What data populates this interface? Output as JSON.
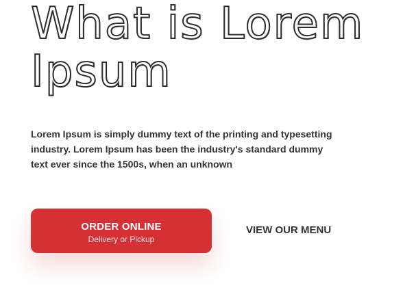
{
  "hero": {
    "title": "What is Lorem Ipsum",
    "description": "Lorem Ipsum is simply dummy text of the printing and typesetting industry. Lorem Ipsum has been the industry's standard dummy text ever since the 1500s, when an unknown"
  },
  "actions": {
    "order": {
      "label": "ORDER ONLINE",
      "sublabel": "Delivery or Pickup"
    },
    "menu": {
      "label": "VIEW OUR MENU"
    }
  },
  "colors": {
    "accent": "#d53135",
    "text": "#333333",
    "background": "#ffffff"
  }
}
